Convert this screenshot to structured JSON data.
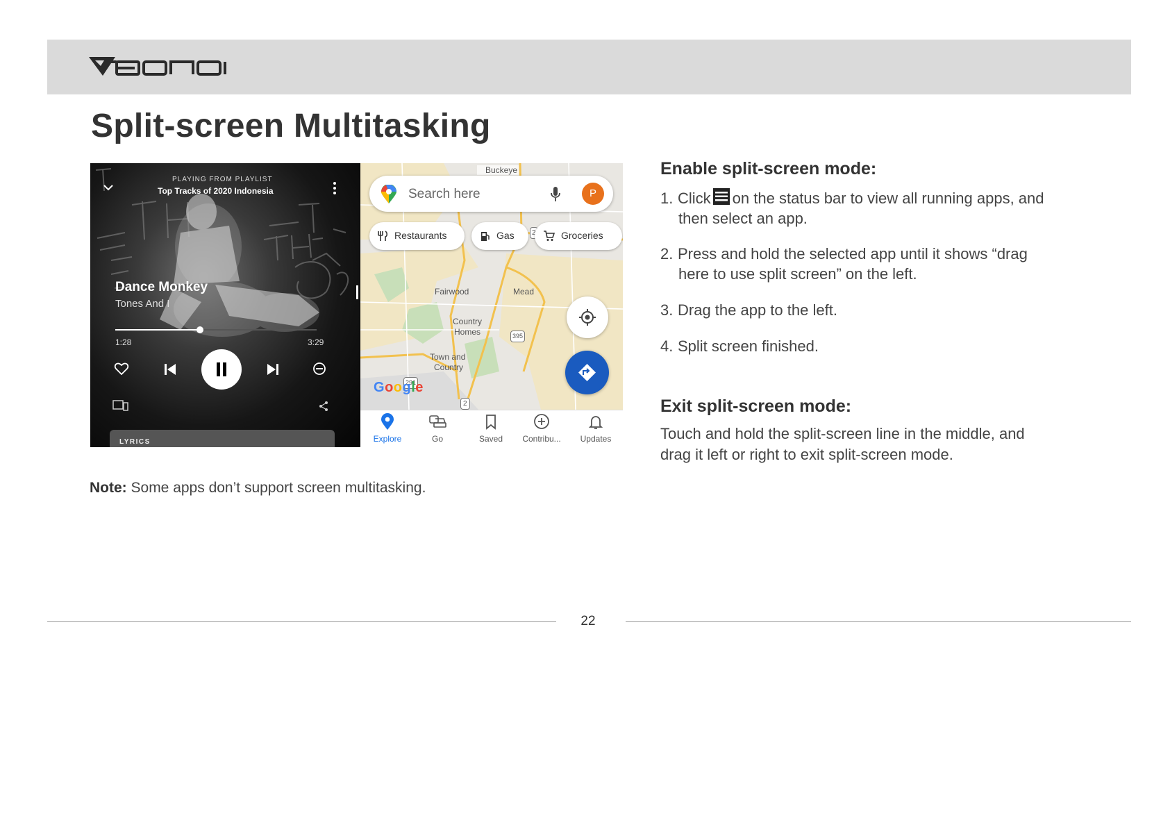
{
  "header": {
    "logo_icon": "eonon-logo"
  },
  "page_title": "Split-screen Multitasking",
  "screenshot": {
    "music": {
      "playing_from": "PLAYING FROM PLAYLIST",
      "playlist": "Top Tracks of 2020 Indonesia",
      "song_title": "Dance Monkey",
      "artist": "Tones And I",
      "time_current": "1:28",
      "time_total": "3:29",
      "progress": 0.42,
      "lyrics_label": "LYRICS"
    },
    "maps": {
      "search_placeholder": "Search here",
      "avatar_initial": "P",
      "chips": [
        "Restaurants",
        "Gas",
        "Groceries"
      ],
      "places": {
        "buckeye": "Buckeye",
        "fairwood": "Fairwood",
        "mead": "Mead",
        "country_homes_1": "Country",
        "country_homes_2": "Homes",
        "town_country_1": "Town and",
        "town_country_2": "Country",
        "route_395": "395",
        "route_291": "291",
        "route_2": "2",
        "route_2b": "2"
      },
      "google_letters": [
        "G",
        "o",
        "o",
        "g",
        "l",
        "e"
      ],
      "google_colors": [
        "#4285F4",
        "#EA4335",
        "#FBBC05",
        "#4285F4",
        "#34A853",
        "#EA4335"
      ],
      "nav": [
        "Explore",
        "Go",
        "Saved",
        "Contribu...",
        "Updates"
      ],
      "accent_color": "#1a73e8"
    }
  },
  "enable": {
    "heading": "Enable split-screen mode:",
    "step1_num": "1.",
    "step1_a": "Click",
    "step1_b": "on the status bar to view all running apps, and",
    "step1_c": "then select an app.",
    "step2_num": "2.",
    "step2_a": "Press and hold the selected app until it shows “drag",
    "step2_b": "here to use split screen” on the left.",
    "step3_num": "3.",
    "step3": "Drag the app to the left.",
    "step4_num": "4.",
    "step4": "Split screen finished."
  },
  "exit": {
    "heading": "Exit split-screen mode:",
    "line1": "Touch and hold the split-screen line in the middle, and",
    "line2": "drag it left or right to exit split-screen mode."
  },
  "note": {
    "label": "Note:",
    "text": " Some apps don’t support screen multitasking."
  },
  "page_number": "22"
}
